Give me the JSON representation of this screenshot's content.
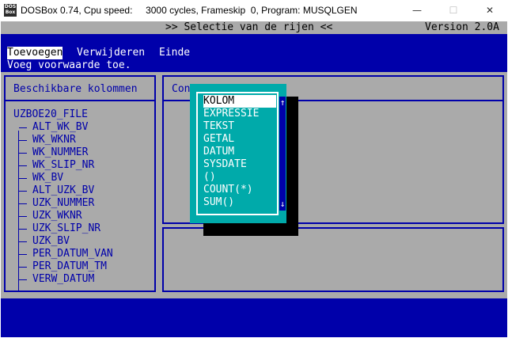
{
  "window": {
    "title": "DOSBox 0.74, Cpu speed:     3000 cycles, Frameskip  0, Program: MUSQLGEN",
    "icon_text": "DOS\nBox",
    "controls": [
      "—",
      "☐",
      "✕"
    ]
  },
  "dos": {
    "header": {
      "title": ">> Selectie van de rijen <<",
      "version": "Version 2.0A"
    },
    "menu": {
      "items": [
        "Toevoegen",
        "Verwijderen",
        "Einde"
      ],
      "selected": "Toevoegen"
    },
    "hint": "Voeg voorwaarde toe.",
    "left_panel": {
      "title": "Beschikbare kolommen",
      "table": "UZBOE20_FILE",
      "columns": [
        "ALT_WK_BV",
        "WK_WKNR",
        "WK_NUMMER",
        "WK_SLIP_NR",
        "WK_BV",
        "ALT_UZK_BV",
        "UZK_NUMMER",
        "UZK_WKNR",
        "UZK_SLIP_NR",
        "UZK_BV",
        "PER_DATUM_VAN",
        "PER_DATUM_TM",
        "VERW_DATUM"
      ]
    },
    "right_panel": {
      "title_visible": "Con"
    },
    "popup": {
      "items": [
        "KOLOM",
        "EXPRESSIE",
        "TEKST",
        "GETAL",
        "DATUM",
        "SYSDATE",
        "()",
        "COUNT(*)",
        "SUM()"
      ],
      "selected": "KOLOM",
      "scroll_up": "↑",
      "scroll_down": "↓"
    },
    "colors": {
      "background": "#0000aa",
      "panel": "#aaaaaa",
      "popup": "#00aaaa",
      "text_light": "#ffffff"
    }
  }
}
